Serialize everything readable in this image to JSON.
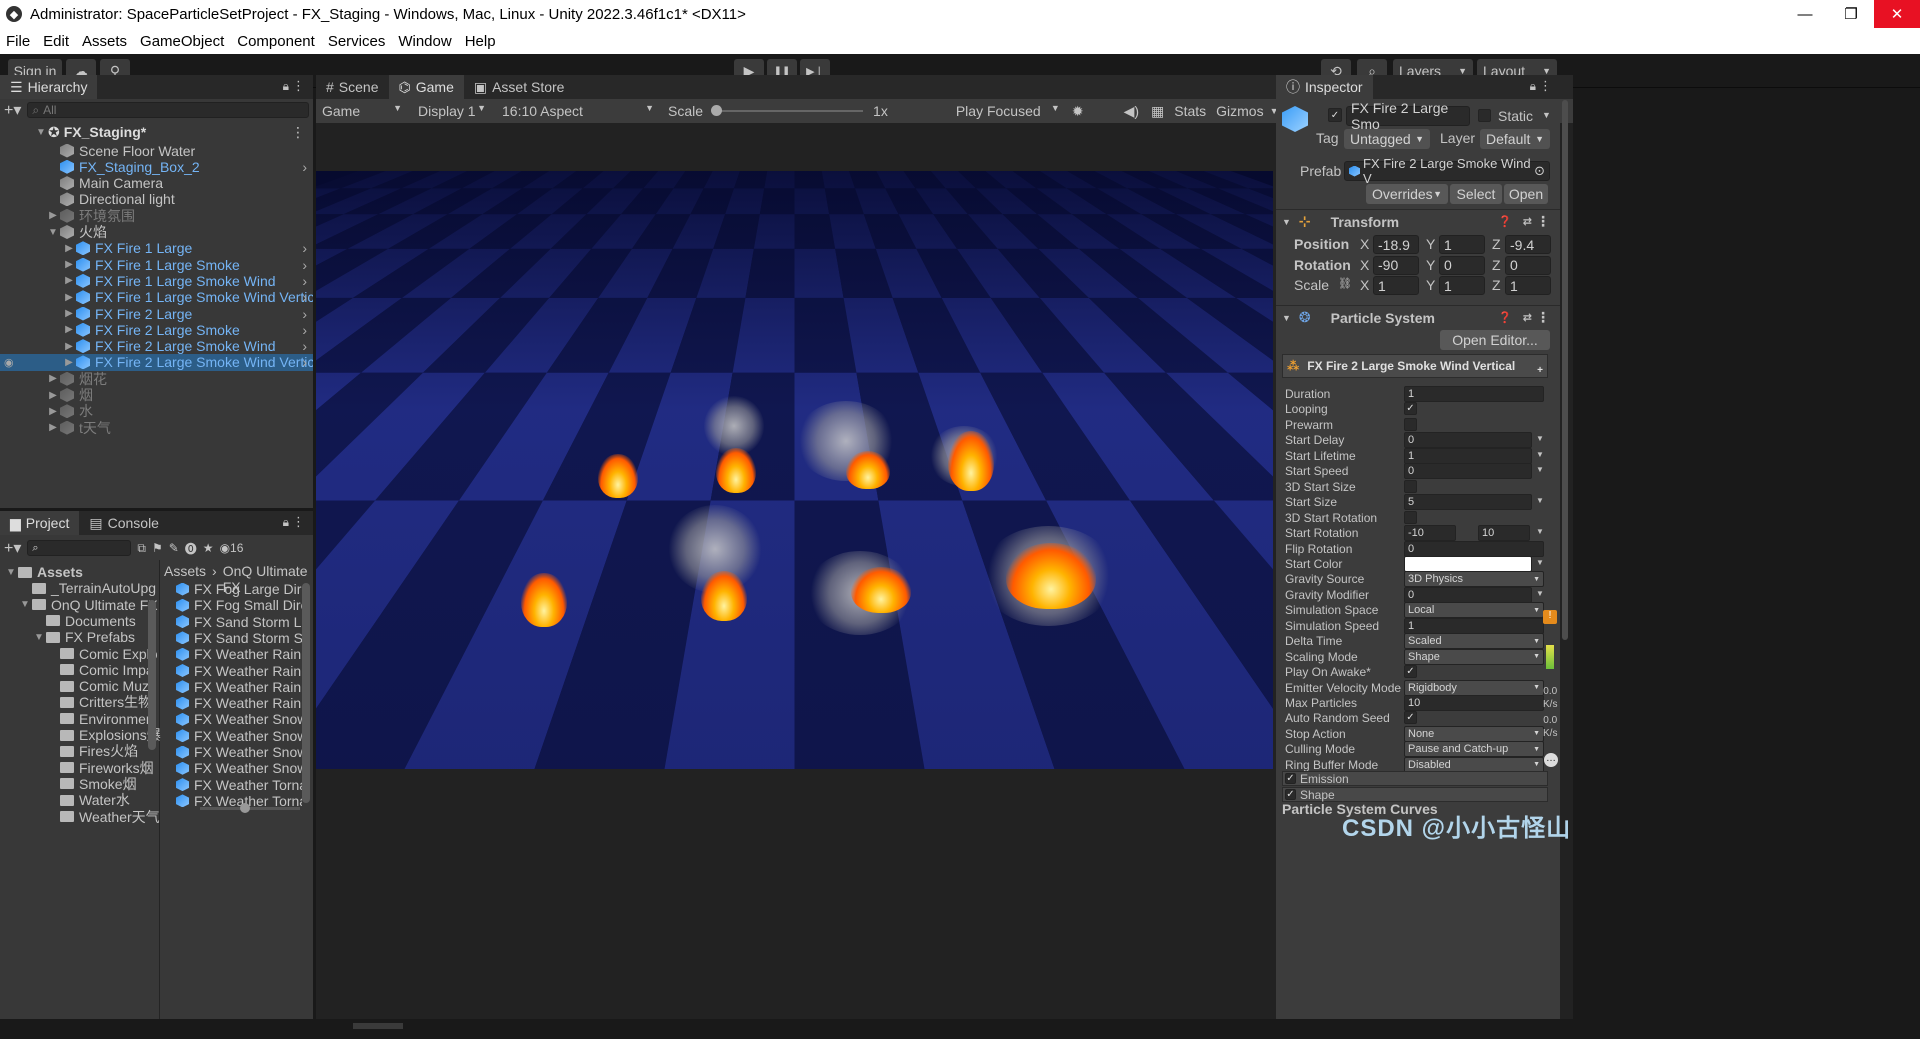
{
  "titlebar": {
    "title": "Administrator: SpaceParticleSetProject - FX_Staging - Windows, Mac, Linux - Unity 2022.3.46f1c1* <DX11>",
    "minimize": "—",
    "restore": "❐",
    "close": "✕"
  },
  "menu": [
    "File",
    "Edit",
    "Assets",
    "GameObject",
    "Component",
    "Services",
    "Window",
    "Help"
  ],
  "toolbar": {
    "sign_in": "Sign in",
    "layers": "Layers",
    "layout": "Layout",
    "play": "▶",
    "pause": "❚❚",
    "step": "▶❘"
  },
  "hierarchy": {
    "tab": "Hierarchy",
    "search_placeholder": "All",
    "scene": "FX_Staging*",
    "items": [
      {
        "label": "Scene Floor Water",
        "style": "normal",
        "indent": 1,
        "icon": "gray",
        "arrow": ""
      },
      {
        "label": "FX_Staging_Box_2",
        "style": "blue",
        "indent": 1,
        "icon": "blue",
        "arrow": "",
        "chev": true
      },
      {
        "label": "Main Camera",
        "style": "normal",
        "indent": 1,
        "icon": "gray",
        "arrow": ""
      },
      {
        "label": "Directional light",
        "style": "normal",
        "indent": 1,
        "icon": "gray",
        "arrow": ""
      },
      {
        "label": "环境氛围",
        "style": "dim",
        "indent": 1,
        "icon": "dim",
        "arrow": "▶"
      },
      {
        "label": "火焰",
        "style": "normal",
        "indent": 1,
        "icon": "gray",
        "arrow": "▼"
      },
      {
        "label": "FX Fire 1 Large",
        "style": "blue",
        "indent": 2,
        "icon": "blue",
        "arrow": "▶",
        "chev": true
      },
      {
        "label": "FX Fire 1 Large Smoke",
        "style": "blue",
        "indent": 2,
        "icon": "blue",
        "arrow": "▶",
        "chev": true
      },
      {
        "label": "FX Fire 1 Large Smoke Wind",
        "style": "blue",
        "indent": 2,
        "icon": "blue",
        "arrow": "▶",
        "chev": true
      },
      {
        "label": "FX Fire 1 Large Smoke Wind Vertic",
        "style": "blue",
        "indent": 2,
        "icon": "blue",
        "arrow": "▶",
        "chev": true
      },
      {
        "label": "FX Fire 2 Large",
        "style": "blue",
        "indent": 2,
        "icon": "blue",
        "arrow": "▶",
        "chev": true
      },
      {
        "label": "FX Fire 2 Large Smoke",
        "style": "blue",
        "indent": 2,
        "icon": "blue",
        "arrow": "▶",
        "chev": true
      },
      {
        "label": "FX Fire 2 Large Smoke Wind",
        "style": "blue",
        "indent": 2,
        "icon": "blue",
        "arrow": "▶",
        "chev": true
      },
      {
        "label": "FX Fire 2 Large Smoke Wind Vertic",
        "style": "blue",
        "indent": 2,
        "icon": "blue",
        "arrow": "▶",
        "chev": true,
        "selected": true
      },
      {
        "label": "烟花",
        "style": "dim",
        "indent": 1,
        "icon": "dim",
        "arrow": "▶"
      },
      {
        "label": "烟",
        "style": "dim",
        "indent": 1,
        "icon": "dim",
        "arrow": "▶"
      },
      {
        "label": "水",
        "style": "dim",
        "indent": 1,
        "icon": "dim",
        "arrow": "▶"
      },
      {
        "label": "t天气",
        "style": "dim",
        "indent": 1,
        "icon": "dim",
        "arrow": "▶"
      }
    ]
  },
  "project": {
    "tabs": [
      "Project",
      "Console"
    ],
    "badge": "16",
    "tree": [
      {
        "label": "Assets",
        "indent": 0,
        "arrow": "▼",
        "bold": true
      },
      {
        "label": "_TerrainAutoUpg",
        "indent": 1,
        "arrow": ""
      },
      {
        "label": "OnQ Ultimate FX",
        "indent": 1,
        "arrow": "▼"
      },
      {
        "label": "Documents",
        "indent": 2,
        "arrow": ""
      },
      {
        "label": "FX Prefabs",
        "indent": 2,
        "arrow": "▼"
      },
      {
        "label": "Comic Explo",
        "indent": 3,
        "arrow": ""
      },
      {
        "label": "Comic Impa",
        "indent": 3,
        "arrow": ""
      },
      {
        "label": "Comic Muz",
        "indent": 3,
        "arrow": ""
      },
      {
        "label": "Critters生物",
        "indent": 3,
        "arrow": ""
      },
      {
        "label": "Environmen",
        "indent": 3,
        "arrow": ""
      },
      {
        "label": "Explosions爆",
        "indent": 3,
        "arrow": ""
      },
      {
        "label": "Fires火焰",
        "indent": 3,
        "arrow": ""
      },
      {
        "label": "Fireworks烟",
        "indent": 3,
        "arrow": ""
      },
      {
        "label": "Smoke烟",
        "indent": 3,
        "arrow": ""
      },
      {
        "label": "Water水",
        "indent": 3,
        "arrow": ""
      },
      {
        "label": "Weather天气",
        "indent": 3,
        "arrow": ""
      }
    ],
    "breadcrumb": [
      "Assets",
      "OnQ Ultimate FX"
    ],
    "files": [
      "FX Fog Large Dire",
      "FX Fog Small Direc",
      "FX Sand Storm Lar",
      "FX Sand Storm Sm",
      "FX Weather Rainin",
      "FX Weather Rainin",
      "FX Weather Rainin",
      "FX Weather Rainin",
      "FX Weather Snowi",
      "FX Weather Snowi",
      "FX Weather Snowi",
      "FX Weather Snowi",
      "FX Weather Torna",
      "FX Weather Torna"
    ]
  },
  "game": {
    "tabs": [
      "Scene",
      "Game",
      "Asset Store"
    ],
    "mode": "Game",
    "display": "Display 1",
    "aspect": "16:10 Aspect",
    "scale_label": "Scale",
    "scale_value": "1x",
    "scale_fraction": 0.0,
    "play_focused": "Play Focused",
    "stats": "Stats",
    "gizmos": "Gizmos"
  },
  "inspector": {
    "tab": "Inspector",
    "object_name": "FX Fire 2 Large Smo",
    "static": "Static",
    "tag_label": "Tag",
    "tag": "Untagged",
    "layer_label": "Layer",
    "layer": "Default",
    "prefab_label": "Prefab",
    "prefab": "FX Fire 2 Large Smoke Wind V",
    "overrides": "Overrides",
    "select": "Select",
    "open": "Open",
    "transform": {
      "title": "Transform",
      "position_label": "Position",
      "rotation_label": "Rotation",
      "scale_label": "Scale",
      "position": {
        "x": "-18.9",
        "y": "1",
        "z": "-9.4"
      },
      "rotation": {
        "x": "-90",
        "y": "0",
        "z": "0"
      },
      "scale": {
        "x": "1",
        "y": "1",
        "z": "1"
      }
    },
    "particle": {
      "title": "Particle System",
      "open_editor": "Open Editor...",
      "system_name": "FX Fire 2 Large Smoke Wind Vertical",
      "rows": [
        {
          "label": "Duration",
          "value": "1",
          "type": "field"
        },
        {
          "label": "Looping",
          "value": "✓",
          "type": "check"
        },
        {
          "label": "Prewarm",
          "value": "",
          "type": "check"
        },
        {
          "label": "Start Delay",
          "value": "0",
          "type": "field",
          "arrow": true
        },
        {
          "label": "Start Lifetime",
          "value": "1",
          "type": "field",
          "arrow": true
        },
        {
          "label": "Start Speed",
          "value": "0",
          "type": "field",
          "arrow": true
        },
        {
          "label": "3D Start Size",
          "value": "",
          "type": "check"
        },
        {
          "label": "Start Size",
          "value": "5",
          "type": "field",
          "arrow": true
        },
        {
          "label": "3D Start Rotation",
          "value": "",
          "type": "check"
        },
        {
          "label": "Start Rotation",
          "value": "-10",
          "value2": "10",
          "type": "range",
          "arrow": true
        },
        {
          "label": "Flip Rotation",
          "value": "0",
          "type": "field"
        },
        {
          "label": "Start Color",
          "value": "",
          "type": "color",
          "arrow": true
        },
        {
          "label": "Gravity Source",
          "value": "3D Physics",
          "type": "drop"
        },
        {
          "label": "Gravity Modifier",
          "value": "0",
          "type": "field",
          "arrow": true
        },
        {
          "label": "Simulation Space",
          "value": "Local",
          "type": "drop"
        },
        {
          "label": "Simulation Speed",
          "value": "1",
          "type": "field"
        },
        {
          "label": "Delta Time",
          "value": "Scaled",
          "type": "drop"
        },
        {
          "label": "Scaling Mode",
          "value": "Shape",
          "type": "drop"
        },
        {
          "label": "Play On Awake*",
          "value": "✓",
          "type": "check"
        },
        {
          "label": "Emitter Velocity Mode",
          "value": "Rigidbody",
          "type": "drop"
        },
        {
          "label": "Max Particles",
          "value": "10",
          "type": "field"
        },
        {
          "label": "Auto Random Seed",
          "value": "✓",
          "type": "check"
        },
        {
          "label": "Stop Action",
          "value": "None",
          "type": "drop"
        },
        {
          "label": "Culling Mode",
          "value": "Pause and Catch-up",
          "type": "drop"
        },
        {
          "label": "Ring Buffer Mode",
          "value": "Disabled",
          "type": "drop"
        }
      ],
      "modules": [
        "Emission",
        "Shape"
      ],
      "curves": "Particle System Curves"
    },
    "side_stats": [
      "0.0",
      "K/s",
      "0.0",
      "K/s"
    ]
  },
  "watermark": "CSDN @小小古怪山",
  "colors": {
    "selection": "#2c5d87",
    "prefab_blue": "#74b4f5",
    "floor_dark": "#141c5c",
    "floor_light": "#2a37a0"
  }
}
